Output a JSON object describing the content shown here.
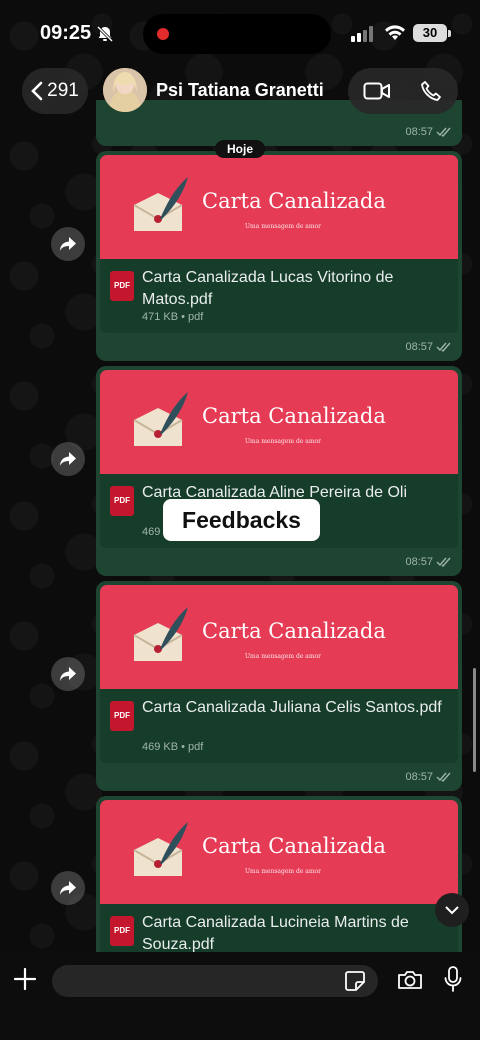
{
  "status": {
    "time": "09:25",
    "battery": "30"
  },
  "header": {
    "back_count": "291",
    "contact_name": "Psi Tatiana Granetti"
  },
  "chat": {
    "date_separator": "Hoje",
    "previous_time": "08:57",
    "overlay_label": "Feedbacks",
    "messages": [
      {
        "banner_title": "Carta Canalizada",
        "banner_subtitle": "Uma mensagem de amor",
        "file_name": "Carta Canalizada  Lucas Vitorino de Matos.pdf",
        "file_meta": "471 KB • pdf",
        "time": "08:57"
      },
      {
        "banner_title": "Carta Canalizada",
        "banner_subtitle": "Uma mensagem de amor",
        "file_name": "Carta Canalizada Aline Pereira de Oli",
        "file_meta": "469",
        "time": "08:57"
      },
      {
        "banner_title": "Carta Canalizada",
        "banner_subtitle": "Uma mensagem de amor",
        "file_name": "Carta Canalizada Juliana Celis Santos.pdf",
        "file_meta": "469 KB • pdf",
        "time": "08:57"
      },
      {
        "banner_title": "Carta Canalizada",
        "banner_subtitle": "Uma mensagem de amor",
        "file_name": "Carta Canalizada Lucineia Martins de Souza.pdf",
        "file_meta": "",
        "time": ""
      }
    ]
  },
  "composer": {
    "input_value": ""
  },
  "icons": {
    "mute": "bell-slash-icon",
    "signal": "cellular-signal-icon",
    "wifi": "wifi-icon",
    "back": "chevron-left-icon",
    "video": "video-call-icon",
    "phone": "phone-icon",
    "forward": "forward-icon",
    "pdf": "pdf-file-icon",
    "read": "double-check-icon",
    "scroll": "chevron-down-icon",
    "plus": "plus-icon",
    "sticker": "sticker-icon",
    "camera": "camera-icon",
    "mic": "microphone-icon"
  },
  "colors": {
    "bubble": "#1d4531",
    "banner": "#e63b55",
    "file_card": "#163d29",
    "pdf": "#c4172e"
  }
}
